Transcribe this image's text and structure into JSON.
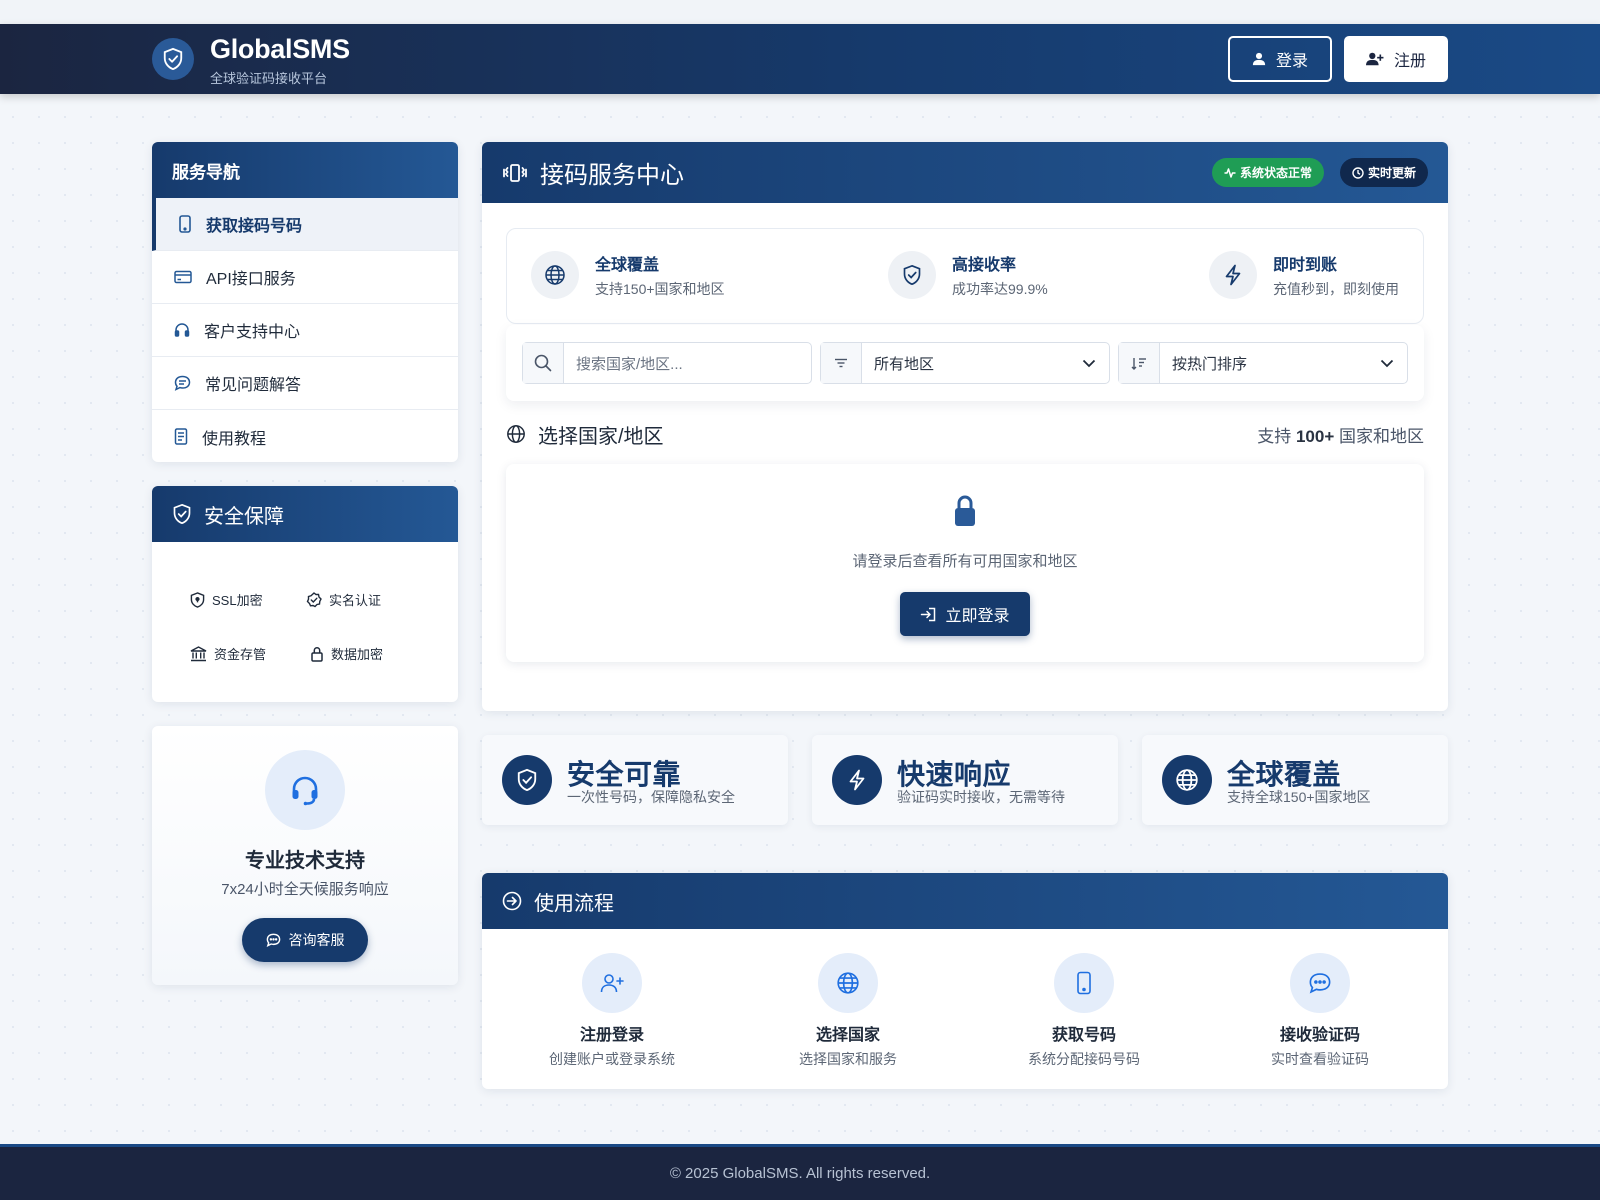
{
  "header": {
    "brand_name": "GlobalSMS",
    "brand_tagline": "全球验证码接收平台",
    "login_label": "登录",
    "register_label": "注册"
  },
  "sidebar": {
    "title": "服务导航",
    "items": [
      {
        "label": "获取接码号码",
        "icon": "smartphone-icon",
        "active": true
      },
      {
        "label": "API接口服务",
        "icon": "credit-card-icon"
      },
      {
        "label": "客户支持中心",
        "icon": "headset-icon"
      },
      {
        "label": "常见问题解答",
        "icon": "chat-bubble-icon"
      },
      {
        "label": "使用教程",
        "icon": "document-icon"
      }
    ]
  },
  "security": {
    "title": "安全保障",
    "items": [
      {
        "label": "SSL加密",
        "icon": "shield-lock-icon"
      },
      {
        "label": "实名认证",
        "icon": "badge-check-icon"
      },
      {
        "label": "资金存管",
        "icon": "bank-icon"
      },
      {
        "label": "数据加密",
        "icon": "lock-icon"
      }
    ]
  },
  "support": {
    "title": "专业技术支持",
    "desc": "7x24小时全天候服务响应",
    "button_label": "咨询客服"
  },
  "main": {
    "title": "接码服务中心",
    "badge_status": "系统状态正常",
    "badge_realtime": "实时更新",
    "features": [
      {
        "title": "全球覆盖",
        "desc": "支持150+国家和地区",
        "icon": "globe-icon"
      },
      {
        "title": "高接收率",
        "desc": "成功率达99.9%",
        "icon": "shield-check-icon"
      },
      {
        "title": "即时到账",
        "desc": "充值秒到，即刻使用",
        "icon": "lightning-icon"
      }
    ],
    "search": {
      "placeholder": "搜索国家/地区..."
    },
    "region_select": {
      "value": "所有地区"
    },
    "sort_select": {
      "value": "按热门排序"
    },
    "select_title": "选择国家/地区",
    "support_count_prefix": "支持",
    "support_count_value": "100+",
    "support_count_suffix": "国家和地区",
    "login_prompt": "请登录后查看所有可用国家和地区",
    "login_now_label": "立即登录"
  },
  "highlights": [
    {
      "title": "安全可靠",
      "desc": "一次性号码，保障隐私安全",
      "icon": "shield-check-icon"
    },
    {
      "title": "快速响应",
      "desc": "验证码实时接收，无需等待",
      "icon": "lightning-icon"
    },
    {
      "title": "全球覆盖",
      "desc": "支持全球150+国家地区",
      "icon": "globe-icon"
    }
  ],
  "flow": {
    "title": "使用流程",
    "steps": [
      {
        "title": "注册登录",
        "desc": "创建账户或登录系统",
        "icon": "user-plus-icon"
      },
      {
        "title": "选择国家",
        "desc": "选择国家和服务",
        "icon": "globe-icon"
      },
      {
        "title": "获取号码",
        "desc": "系统分配接码号码",
        "icon": "smartphone-icon"
      },
      {
        "title": "接收验证码",
        "desc": "实时查看验证码",
        "icon": "chat-bubble-icon"
      }
    ]
  },
  "footer": {
    "copyright": "© 2025 GlobalSMS. All rights reserved."
  },
  "colors": {
    "primary": "#163a6c",
    "navbar_dark": "#1b2540",
    "success": "#1f9d55",
    "accent_light": "#e4edfa"
  }
}
